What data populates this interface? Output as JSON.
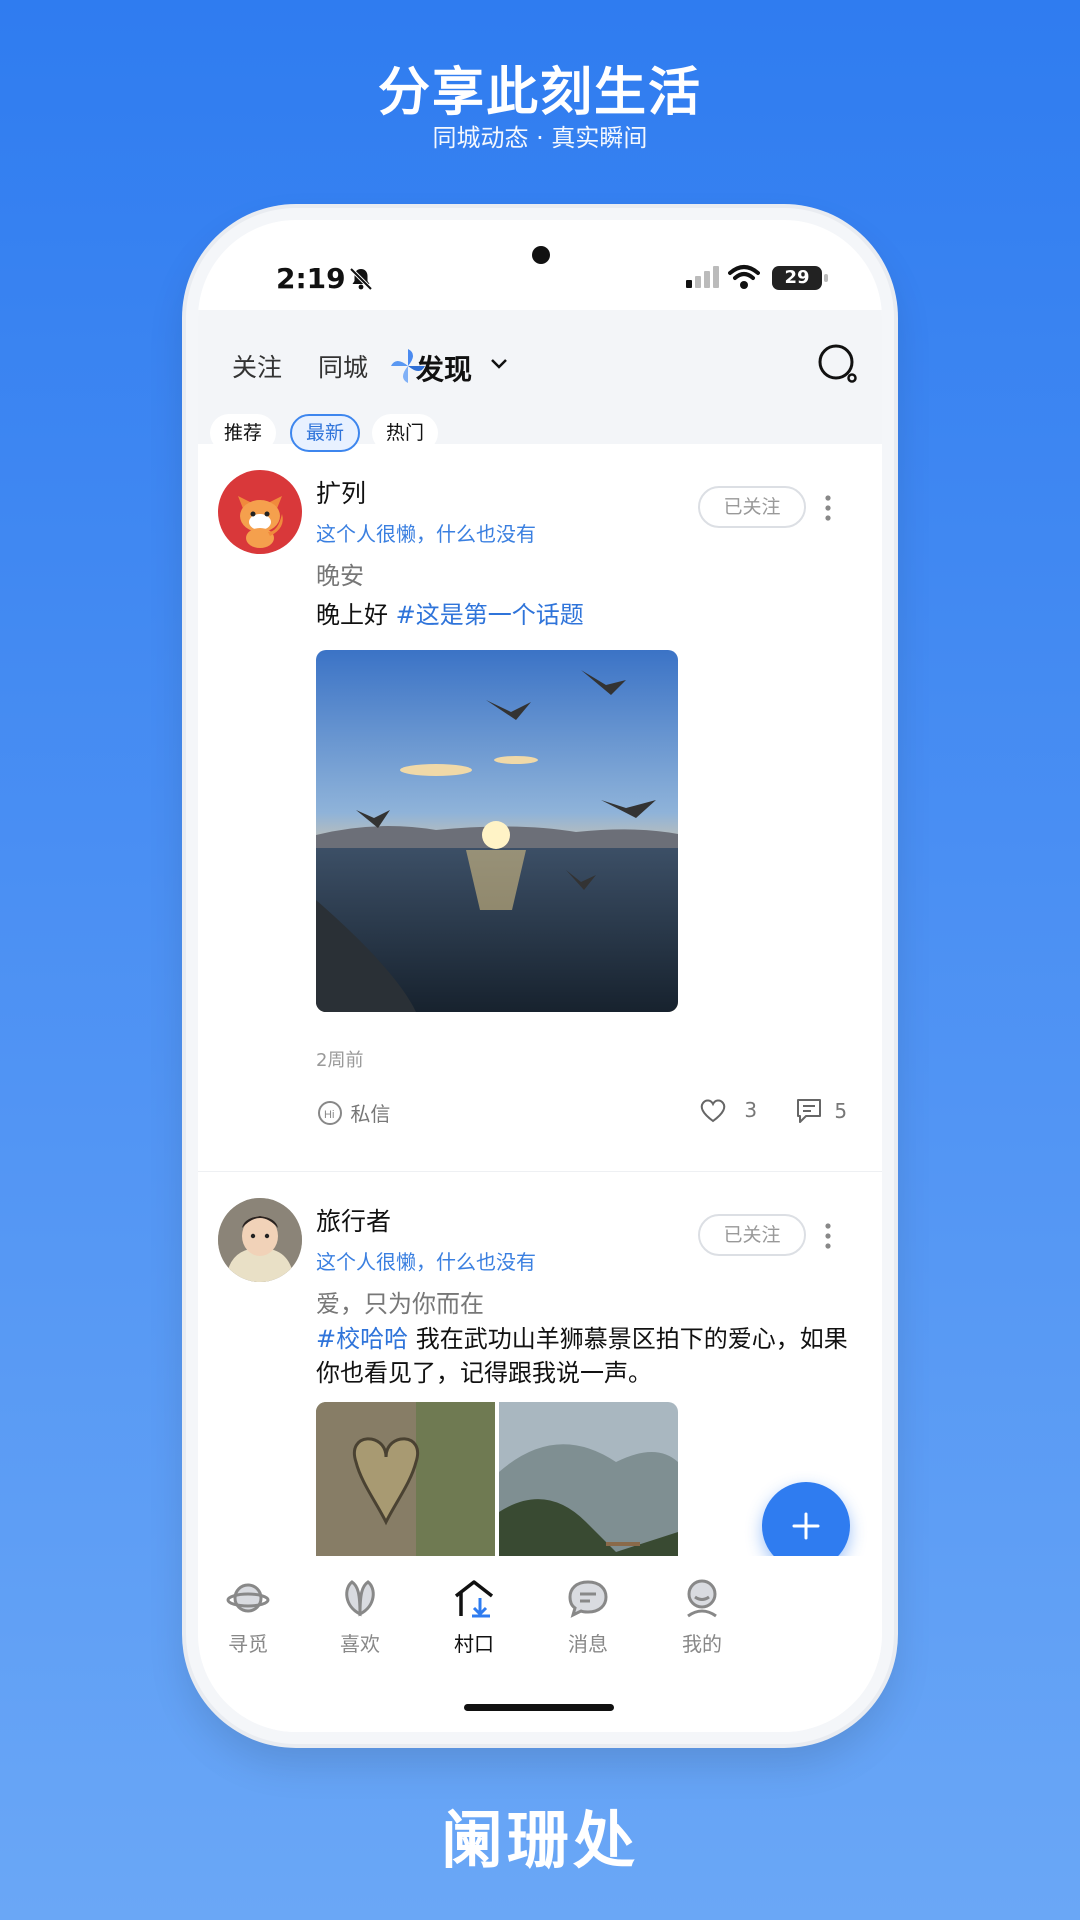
{
  "promo": {
    "title": "分享此刻生活",
    "subtitle": "同城动态 · 真实瞬间",
    "brand": "阑珊处"
  },
  "status_bar": {
    "time": "2:19",
    "battery": "29"
  },
  "top_tabs": {
    "follow": "关注",
    "local": "同城",
    "discover": "发现"
  },
  "chips": {
    "recommend": "推荐",
    "latest": "最新",
    "hot": "热门"
  },
  "posts": [
    {
      "username": "扩列",
      "bio": "这个人很懒，什么也没有",
      "follow_label": "已关注",
      "title": "晚安",
      "text": "晚上好 ",
      "topic": "#这是第一个话题",
      "time": "2周前",
      "dm_label": "私信",
      "likes": "3",
      "comments": "5"
    },
    {
      "username": "旅行者",
      "bio": "这个人很懒，什么也没有",
      "follow_label": "已关注",
      "title": "爱，只为你而在",
      "topic": "#校哈哈",
      "text": " 我在武功山羊狮慕景区拍下的爱心，如果你也看见了，记得跟我说一声。"
    }
  ],
  "bottom_nav": [
    {
      "label": "寻觅"
    },
    {
      "label": "喜欢"
    },
    {
      "label": "村口"
    },
    {
      "label": "消息"
    },
    {
      "label": "我的"
    }
  ],
  "colors": {
    "accent": "#2f7cf0",
    "topic": "#2f74da"
  }
}
